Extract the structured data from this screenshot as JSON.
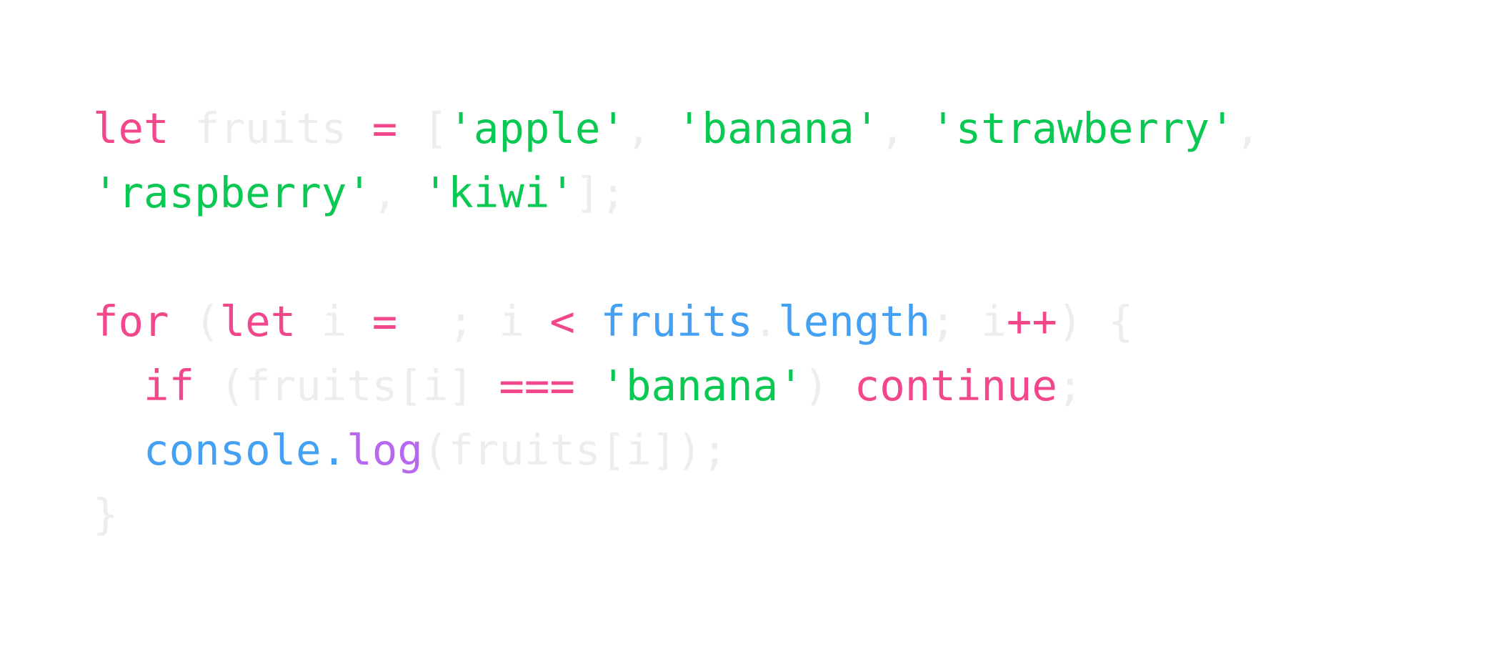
{
  "colors": {
    "keyword": "#f2478a",
    "operator": "#f2478a",
    "string": "#0ac952",
    "property": "#43a0f2",
    "function": "#b767f0",
    "muted": "#ededed",
    "background": "#ffffff"
  },
  "code": {
    "lines": [
      [
        {
          "t": "let",
          "c": "kw"
        },
        {
          "t": " fruits ",
          "c": "muted"
        },
        {
          "t": "=",
          "c": "op"
        },
        {
          "t": " [",
          "c": "muted"
        },
        {
          "t": "'apple'",
          "c": "str"
        },
        {
          "t": ", ",
          "c": "muted"
        },
        {
          "t": "'banana'",
          "c": "str"
        },
        {
          "t": ", ",
          "c": "muted"
        },
        {
          "t": "'strawberry'",
          "c": "str"
        },
        {
          "t": ",",
          "c": "muted"
        }
      ],
      [
        {
          "t": "'raspberry'",
          "c": "str"
        },
        {
          "t": ", ",
          "c": "muted"
        },
        {
          "t": "'kiwi'",
          "c": "str"
        },
        {
          "t": "];",
          "c": "muted"
        }
      ],
      [],
      [
        {
          "t": "for",
          "c": "kw"
        },
        {
          "t": " (",
          "c": "muted"
        },
        {
          "t": "let",
          "c": "kw"
        },
        {
          "t": " i ",
          "c": "muted"
        },
        {
          "t": "=",
          "c": "op"
        },
        {
          "t": "  ; i ",
          "c": "muted"
        },
        {
          "t": "<",
          "c": "op"
        },
        {
          "t": " ",
          "c": "muted"
        },
        {
          "t": "fruits",
          "c": "prop"
        },
        {
          "t": ".",
          "c": "muted"
        },
        {
          "t": "length",
          "c": "prop"
        },
        {
          "t": "; i",
          "c": "muted"
        },
        {
          "t": "++",
          "c": "op"
        },
        {
          "t": ") {",
          "c": "muted"
        }
      ],
      [
        {
          "t": "  ",
          "c": "muted"
        },
        {
          "t": "if",
          "c": "kw"
        },
        {
          "t": " (fruits[i] ",
          "c": "muted"
        },
        {
          "t": "===",
          "c": "op"
        },
        {
          "t": " ",
          "c": "muted"
        },
        {
          "t": "'banana'",
          "c": "str"
        },
        {
          "t": ") ",
          "c": "muted"
        },
        {
          "t": "continue",
          "c": "kw"
        },
        {
          "t": ";",
          "c": "muted"
        }
      ],
      [
        {
          "t": "  ",
          "c": "muted"
        },
        {
          "t": "console",
          "c": "prop"
        },
        {
          "t": ".",
          "c": "prop"
        },
        {
          "t": "log",
          "c": "fn"
        },
        {
          "t": "(fruits[i]);",
          "c": "muted"
        }
      ],
      [
        {
          "t": "}",
          "c": "muted"
        }
      ]
    ]
  }
}
